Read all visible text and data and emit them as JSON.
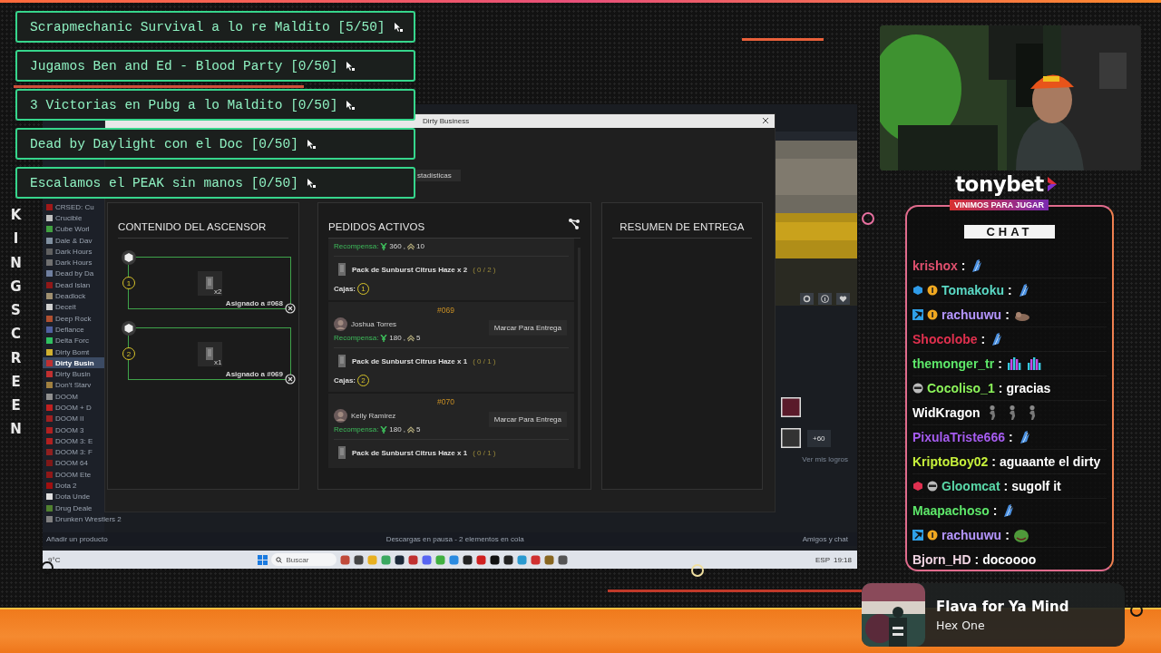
{
  "challenges": [
    {
      "text": "Scrapmechanic Survival a lo re Maldito [5/50]"
    },
    {
      "text": "Jugamos Ben and Ed - Blood Party [0/50]"
    },
    {
      "text": "3 Victorias en Pubg a lo Maldito [0/50]"
    },
    {
      "text": "Dead by Daylight con el Doc [0/50]"
    },
    {
      "text": "Escalamos el PEAK sin manos [0/50]"
    }
  ],
  "side_text": "KINGSCREEN",
  "capture": {
    "window_title": "Dirty Business",
    "tab": "stadísticas",
    "library": [
      {
        "name": "CRSED: Cu",
        "color": "#a01818",
        "selected": false
      },
      {
        "name": "Crucible",
        "color": "#c0c0c0",
        "selected": false
      },
      {
        "name": "Cube Worl",
        "color": "#40a040",
        "selected": false
      },
      {
        "name": "Dale & Dav",
        "color": "#8090a0",
        "selected": false
      },
      {
        "name": "Dark Hours",
        "color": "#606060",
        "selected": false
      },
      {
        "name": "Dark Hours",
        "color": "#707070",
        "selected": false
      },
      {
        "name": "Dead by Da",
        "color": "#7080a0",
        "selected": false
      },
      {
        "name": "Dead Islan",
        "color": "#901818",
        "selected": false
      },
      {
        "name": "Deadlock",
        "color": "#a09070",
        "selected": false
      },
      {
        "name": "Deceit",
        "color": "#d0d0d0",
        "selected": false
      },
      {
        "name": "Deep Rock",
        "color": "#b05030",
        "selected": false
      },
      {
        "name": "Defiance",
        "color": "#5060a0",
        "selected": false
      },
      {
        "name": "Delta Forc",
        "color": "#30c060",
        "selected": false
      },
      {
        "name": "Dirty Bomt",
        "color": "#d0b030",
        "selected": false
      },
      {
        "name": "Dirty Busin",
        "color": "#c03030",
        "selected": true
      },
      {
        "name": "Dirty Busin",
        "color": "#c03030",
        "selected": false
      },
      {
        "name": "Don't Starv",
        "color": "#a08040",
        "selected": false
      },
      {
        "name": "DOOM",
        "color": "#909090",
        "selected": false
      },
      {
        "name": "DOOM + D",
        "color": "#c02020",
        "selected": false
      },
      {
        "name": "DOOM II",
        "color": "#a02020",
        "selected": false
      },
      {
        "name": "DOOM 3",
        "color": "#b02020",
        "selected": false
      },
      {
        "name": "DOOM 3: E",
        "color": "#b02020",
        "selected": false
      },
      {
        "name": "DOOM 3: F",
        "color": "#902020",
        "selected": false
      },
      {
        "name": "DOOM 64",
        "color": "#801818",
        "selected": false
      },
      {
        "name": "DOOM Ete",
        "color": "#901818",
        "selected": false
      },
      {
        "name": "Dota 2",
        "color": "#a01010",
        "selected": false
      },
      {
        "name": "Dota Unde",
        "color": "#e0e0e0",
        "selected": false
      },
      {
        "name": "Drug Deale",
        "color": "#508030",
        "selected": false
      },
      {
        "name": "Drunken Wrestlers 2",
        "color": "#808080",
        "selected": false
      }
    ],
    "elevator": {
      "title": "CONTENIDO DEL ASCENSOR",
      "slots": [
        {
          "number": "1",
          "quantity": "x2",
          "assigned": "Asignado a #068"
        },
        {
          "number": "2",
          "quantity": "x1",
          "assigned": "Asignado a #069"
        }
      ]
    },
    "orders": {
      "title": "PEDIDOS ACTIVOS",
      "list": [
        {
          "reward_label": "Recompensa:",
          "money": "360",
          "xp": "10",
          "separator": ",",
          "items": [
            {
              "name": "Pack de Sunburst Citrus Haze x 2",
              "progress": "( 0 / 2 )",
              "complete": false
            }
          ],
          "boxes_label": "Cajas:",
          "boxes": [
            "1"
          ]
        },
        {
          "id": "#069",
          "customer": "Joshua Torres",
          "action": "Marcar Para Entrega",
          "reward_label": "Recompensa:",
          "money": "180",
          "xp": "5",
          "separator": ",",
          "items": [
            {
              "name": "Pack de Sunburst Citrus Haze x 1",
              "progress": "( 0 / 1 )",
              "complete": false
            }
          ],
          "boxes_label": "Cajas:",
          "boxes": [
            "2"
          ]
        },
        {
          "id": "#070",
          "customer": "Kelly Ramirez",
          "action": "Marcar Para Entrega",
          "reward_label": "Recompensa:",
          "money": "180",
          "xp": "5",
          "separator": ",",
          "items": [
            {
              "name": "Pack de Sunburst Citrus Haze x 1",
              "progress": "( 0 / 1 )",
              "complete": false
            }
          ]
        }
      ]
    },
    "summary": {
      "title": "RESUMEN DE ENTREGA"
    },
    "achievements_extra": "+60",
    "achievements_link": "Ver mis logros",
    "steam_bar": {
      "left": "Añadir un producto",
      "center": "Descargas en pausa - 2 elementos en cola",
      "right": "Amigos y chat"
    },
    "taskbar": {
      "weather": "9°C",
      "search": "Buscar",
      "language": "ESP",
      "time": "19:18"
    }
  },
  "brand": {
    "name": "tonybet",
    "slogan": "VINIMOS PARA JUGAR"
  },
  "chat": {
    "title": "CHAT",
    "messages": [
      {
        "user": "krishox",
        "color": "#e0506e",
        "sep": ":",
        "emotes": [
          {
            "kind": "feather"
          }
        ]
      },
      {
        "user": "Tomakoku",
        "color": "#5ad8c4",
        "badges": [
          {
            "kind": "cube"
          },
          {
            "kind": "coin"
          }
        ],
        "sep": ":",
        "emotes": [
          {
            "kind": "feather"
          }
        ]
      },
      {
        "user": "rachuuwu",
        "color": "#b596ff",
        "badges": [
          {
            "kind": "hammer"
          },
          {
            "kind": "coin"
          }
        ],
        "sep": ":",
        "emotes": [
          {
            "kind": "cat"
          }
        ]
      },
      {
        "user": "Shocolobe",
        "color": "#e0304e",
        "sep": ":",
        "emotes": [
          {
            "kind": "feather"
          }
        ]
      },
      {
        "user": "themonger_tr",
        "color": "#5ee86a",
        "sep": ":",
        "emotes": [
          {
            "kind": "bars"
          },
          {
            "kind": "bars"
          }
        ]
      },
      {
        "user": "Cocoliso_1",
        "color": "#8cf45a",
        "badges": [
          {
            "kind": "mask"
          }
        ],
        "sep": ":",
        "text": "gracias"
      },
      {
        "user": "WidKragon",
        "color": "#ffffff",
        "emotes": [
          {
            "kind": "figure"
          },
          {
            "kind": "figure"
          },
          {
            "kind": "figure"
          }
        ]
      },
      {
        "user": "PixulaTriste666",
        "color": "#a65cf0",
        "sep": ":",
        "emotes": [
          {
            "kind": "feather"
          }
        ]
      },
      {
        "user": "KriptoBoy02",
        "color": "#c8f23c",
        "sep": ":",
        "text": "aguaante el dirty"
      },
      {
        "user": "Gloomcat",
        "color": "#5ad8a8",
        "badges": [
          {
            "kind": "redcube"
          },
          {
            "kind": "mask"
          }
        ],
        "sep": ":",
        "text": "sugolf it"
      },
      {
        "user": "Maapachoso",
        "color": "#5ee86a",
        "sep": ":",
        "emotes": [
          {
            "kind": "feather"
          }
        ]
      },
      {
        "user": "rachuuwu",
        "color": "#b596ff",
        "badges": [
          {
            "kind": "hammer"
          },
          {
            "kind": "coin"
          }
        ],
        "sep": ":",
        "emotes": [
          {
            "kind": "frog"
          }
        ]
      },
      {
        "user": "Bjorn_HD",
        "color": "#f2d6e4",
        "sep": ":",
        "text": "docoooo"
      }
    ]
  },
  "now_playing": {
    "title": "Flava for Ya Mind",
    "artist": "Hex One"
  }
}
